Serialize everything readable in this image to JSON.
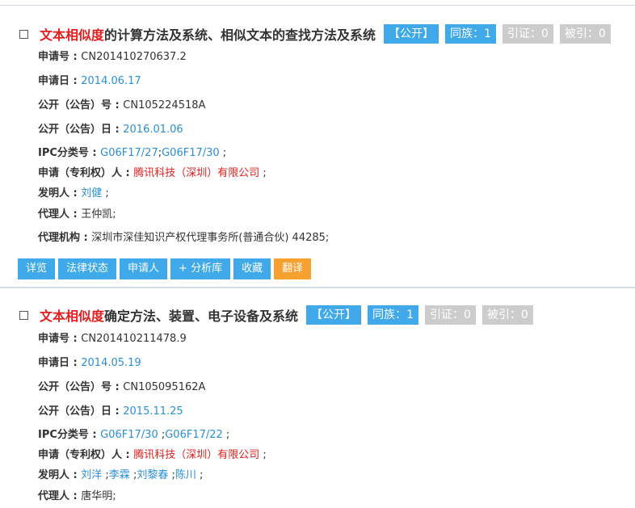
{
  "records": [
    {
      "title_highlight": "文本相似度",
      "title_rest": "的计算方法及系统、相似文本的查找方法及系统",
      "status_badge": "【公开】",
      "family": "同族：1",
      "citing": "引证：0",
      "cited": "被引：0",
      "app_no_label": "申请号 : ",
      "app_no": "CN201410270637.2",
      "app_date_label": "申请日 : ",
      "app_date": "2014.06.17",
      "pub_no_label": "公开（公告）号 : ",
      "pub_no": "CN105224518A",
      "pub_date_label": "公开（公告）日 : ",
      "pub_date": "2016.01.06",
      "ipc_label": "IPC分类号 : ",
      "ipc": [
        "G06F17/27",
        "G06F17/30"
      ],
      "applicant_label": "申请（专利权）人 : ",
      "applicant": "腾讯科技（深圳）有限公司",
      "inventor_label": "发明人 : ",
      "inventors": [
        "刘健"
      ],
      "agent_label": "代理人 : ",
      "agent": "王仲凯;",
      "agency_label": "代理机构 : ",
      "agency": "深圳市深佳知识产权代理事务所(普通合伙) 44285;",
      "actions": {
        "detail": "详览",
        "legal_status": "法律状态",
        "applicant": "申请人",
        "add_library": "+ 分析库",
        "favorite": "收藏",
        "translate": "翻译"
      }
    },
    {
      "title_highlight": "文本相似度",
      "title_rest": "确定方法、装置、电子设备及系统",
      "status_badge": "【公开】",
      "family": "同族：1",
      "citing": "引证：0",
      "cited": "被引：0",
      "app_no_label": "申请号 : ",
      "app_no": "CN201410211478.9",
      "app_date_label": "申请日 : ",
      "app_date": "2014.05.19",
      "pub_no_label": "公开（公告）号 : ",
      "pub_no": "CN105095162A",
      "pub_date_label": "公开（公告）日 : ",
      "pub_date": "2015.11.25",
      "ipc_label": "IPC分类号 : ",
      "ipc": [
        "G06F17/30",
        "G06F17/22"
      ],
      "applicant_label": "申请（专利权）人 : ",
      "applicant": "腾讯科技（深圳）有限公司",
      "inventor_label": "发明人 : ",
      "inventors": [
        "刘洋",
        "李霖",
        "刘黎春",
        "陈川"
      ],
      "agent_label": "代理人 : ",
      "agent": "唐华明;"
    }
  ],
  "separators": {
    "semicolon": " ;",
    "semicolon_tight": ";"
  }
}
